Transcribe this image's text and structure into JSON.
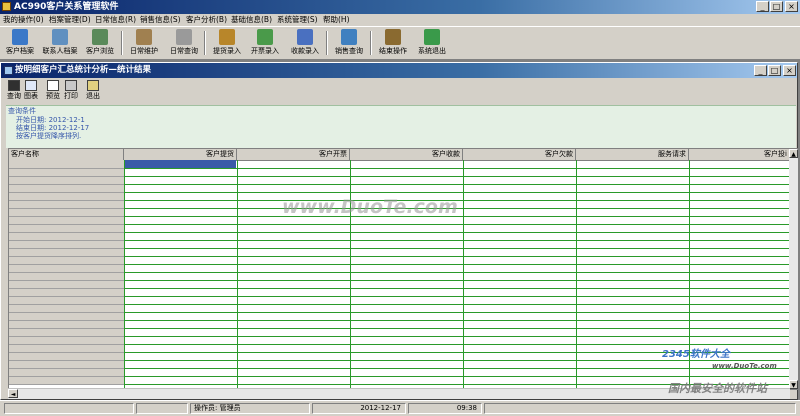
{
  "app": {
    "title": "AC990客户关系管理软件"
  },
  "menu": [
    "我的操作(0)",
    "档案管理(D)",
    "日常信息(R)",
    "销售信息(S)",
    "客户分析(B)",
    "基础信息(B)",
    "系统管理(S)",
    "帮助(H)"
  ],
  "toolbar": [
    {
      "label": "客户档案",
      "icon": "customer-archive-icon",
      "color": "#3a78c8"
    },
    {
      "label": "联系人档案",
      "icon": "contacts-icon",
      "color": "#6090c0"
    },
    {
      "label": "客户浏览",
      "icon": "browse-icon",
      "color": "#5a8a5a"
    },
    {
      "label": "日常维护",
      "icon": "maintenance-icon",
      "color": "#a08050"
    },
    {
      "label": "日常查询",
      "icon": "query-icon",
      "color": "#9a9a9a"
    },
    {
      "label": "提货录入",
      "icon": "delivery-icon",
      "color": "#b8862a"
    },
    {
      "label": "开票录入",
      "icon": "invoice-icon",
      "color": "#4a9a4a"
    },
    {
      "label": "收款录入",
      "icon": "receipt-icon",
      "color": "#4a70c0"
    },
    {
      "label": "销售查询",
      "icon": "sales-query-icon",
      "color": "#4080c0"
    },
    {
      "label": "结束操作",
      "icon": "end-icon",
      "color": "#8a6a30"
    },
    {
      "label": "系统退出",
      "icon": "exit-icon",
      "color": "#3a9a4a"
    }
  ],
  "child": {
    "title": "按明细客户汇总统计分析—统计结果",
    "toolbar": [
      {
        "label": "查询",
        "icon": "query-icon"
      },
      {
        "label": "图表",
        "icon": "chart-icon"
      },
      {
        "label": "预览",
        "icon": "preview-icon"
      },
      {
        "label": "打印",
        "icon": "print-icon"
      },
      {
        "label": "退出",
        "icon": "exit-icon"
      }
    ]
  },
  "conditions": {
    "heading": "查询条件",
    "start": "开始日期: 2012-12-1",
    "end": "结束日期: 2012-12-17",
    "sort": "按客户提货降序排列."
  },
  "grid": {
    "columns": [
      "客户名称",
      "客户提货",
      "客户开票",
      "客户收款",
      "客户欠款",
      "服务请求",
      "客户投i"
    ]
  },
  "status": {
    "operator": "操作员: 管理员",
    "date": "2012-12-17",
    "time": "09:38"
  },
  "watermarks": {
    "main": "www.DuoTe.com",
    "corner_brand": "2345软件大全",
    "corner_url": "www.DuoTe.com",
    "corner_slogan": "国内最安全的软件站"
  }
}
